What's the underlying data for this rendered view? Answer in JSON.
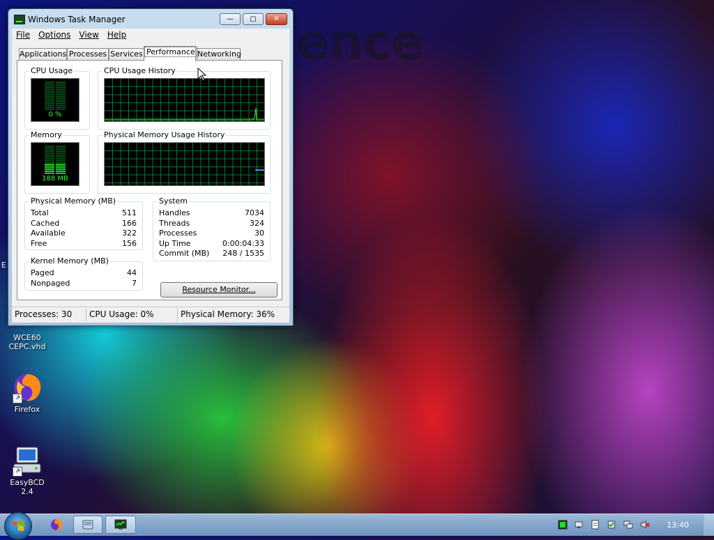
{
  "window": {
    "title": "Windows Task Manager",
    "minimize": "—",
    "maximize": "▢",
    "close": "✕"
  },
  "menu": [
    "File",
    "Options",
    "View",
    "Help"
  ],
  "tabs": [
    "Applications",
    "Processes",
    "Services",
    "Performance",
    "Networking"
  ],
  "active_tab": "Performance",
  "cpu_usage": {
    "title": "CPU Usage",
    "value": "0 %",
    "fraction": 0.0
  },
  "cpu_history": {
    "title": "CPU Usage History"
  },
  "memory": {
    "title": "Memory",
    "value": "188 MB",
    "fraction": 0.36
  },
  "memory_history": {
    "title": "Physical Memory Usage History"
  },
  "physical_memory": {
    "title": "Physical Memory (MB)",
    "rows": [
      {
        "label": "Total",
        "value": "511"
      },
      {
        "label": "Cached",
        "value": "166"
      },
      {
        "label": "Available",
        "value": "322"
      },
      {
        "label": "Free",
        "value": "156"
      }
    ]
  },
  "kernel_memory": {
    "title": "Kernel Memory (MB)",
    "rows": [
      {
        "label": "Paged",
        "value": "44"
      },
      {
        "label": "Nonpaged",
        "value": "7"
      }
    ]
  },
  "system": {
    "title": "System",
    "rows": [
      {
        "label": "Handles",
        "value": "7034"
      },
      {
        "label": "Threads",
        "value": "324"
      },
      {
        "label": "Processes",
        "value": "30"
      },
      {
        "label": "Up Time",
        "value": "0:00:04:33"
      },
      {
        "label": "Commit (MB)",
        "value": "248 / 1535"
      }
    ]
  },
  "resource_monitor_button": "Resource Monitor...",
  "status": {
    "processes": "Processes: 30",
    "cpu": "CPU Usage: 0%",
    "memory": "Physical Memory: 36%"
  },
  "desktop": {
    "background_text": "ence",
    "edge_label": "E",
    "icons": [
      {
        "label_line1": "WCE60",
        "label_line2": "CEPC.vhd",
        "icon": "vhd-file-icon"
      },
      {
        "label_line1": "Firefox",
        "label_line2": "",
        "icon": "firefox-icon"
      },
      {
        "label_line1": "EasyBCD 2.4",
        "label_line2": "",
        "icon": "easybcd-icon"
      }
    ]
  },
  "taskbar": {
    "clock": "13:40"
  },
  "colors": {
    "graph_grid": "#0a7a2a",
    "graph_line": "#2dff2d",
    "memory_line": "#3b9bff",
    "meter_lit": "#2dff2d",
    "meter_dim": "#0a5a1a"
  }
}
